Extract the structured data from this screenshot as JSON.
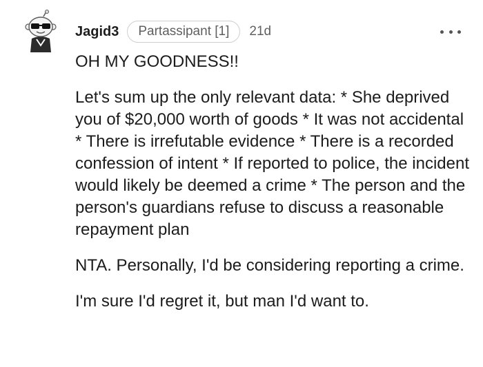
{
  "comment": {
    "username": "Jagid3",
    "flair": "Partassipant [1]",
    "age": "21d",
    "paragraphs": [
      "OH MY GOODNESS!!",
      "Let's sum up the only relevant data: * She deprived you of $20,000 worth of goods * It was not accidental * There is irrefutable evidence * There is a recorded confession of intent * If reported to police, the incident would likely be deemed a crime * The person and the person's guardians refuse to discuss a reasonable repayment plan",
      "NTA. Personally, I'd be considering reporting a crime.",
      "I'm sure I'd regret it, but man I'd want to."
    ]
  },
  "icons": {
    "avatar": "snoo-avatar-sunglasses-icon",
    "more": "more-options-icon"
  },
  "colors": {
    "text": "#1c1c1c",
    "meta": "#5f5f5f",
    "flair_border": "#cfcfcf"
  }
}
